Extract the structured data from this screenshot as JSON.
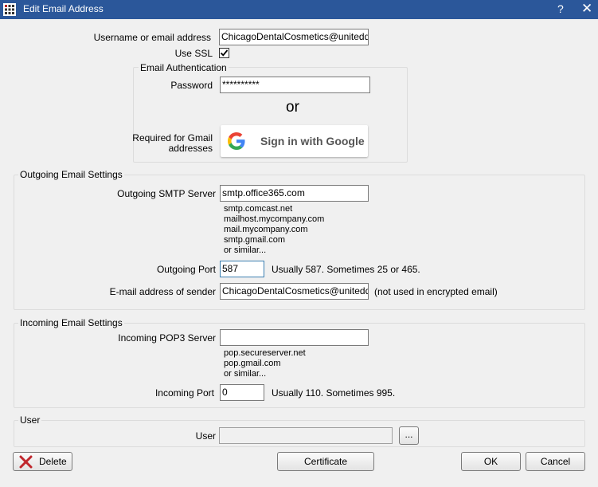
{
  "window": {
    "title": "Edit Email Address",
    "help": "?",
    "close": "✕"
  },
  "account": {
    "username_label": "Username or email address",
    "username_value": "ChicagoDentalCosmetics@uniteddenta",
    "ssl_label": "Use SSL",
    "ssl_checked": true
  },
  "auth": {
    "group_title": "Email Authentication",
    "password_label": "Password",
    "password_value": "**********",
    "or": "or",
    "gmail_label_line1": "Required for Gmail",
    "gmail_label_line2": "addresses",
    "google_button": "Sign in with Google"
  },
  "outgoing": {
    "group_title": "Outgoing Email Settings",
    "smtp_label": "Outgoing SMTP Server",
    "smtp_value": "smtp.office365.com",
    "examples": [
      "smtp.comcast.net",
      "mailhost.mycompany.com",
      "mail.mycompany.com",
      "smtp.gmail.com",
      "or similar..."
    ],
    "port_label": "Outgoing Port",
    "port_value": "587",
    "port_hint": "Usually 587.  Sometimes 25 or 465.",
    "sender_label": "E-mail address of sender",
    "sender_value": "ChicagoDentalCosmetics@uniteddenta",
    "sender_hint": "(not used in encrypted email)"
  },
  "incoming": {
    "group_title": "Incoming Email Settings",
    "pop3_label": "Incoming POP3 Server",
    "pop3_value": "",
    "examples": [
      "pop.secureserver.net",
      "pop.gmail.com",
      "or similar..."
    ],
    "port_label": "Incoming Port",
    "port_value": "0",
    "port_hint": "Usually 110.  Sometimes 995."
  },
  "user": {
    "group_title": "User",
    "user_label": "User",
    "user_value": "",
    "browse": "..."
  },
  "buttons": {
    "delete": "Delete",
    "certificate": "Certificate",
    "ok": "OK",
    "cancel": "Cancel"
  },
  "colors": {
    "titlebar": "#2b579a",
    "delete_icon": "#c0272d",
    "google_blue": "#4285F4",
    "google_red": "#EA4335",
    "google_yellow": "#FBBC05",
    "google_green": "#34A853"
  }
}
